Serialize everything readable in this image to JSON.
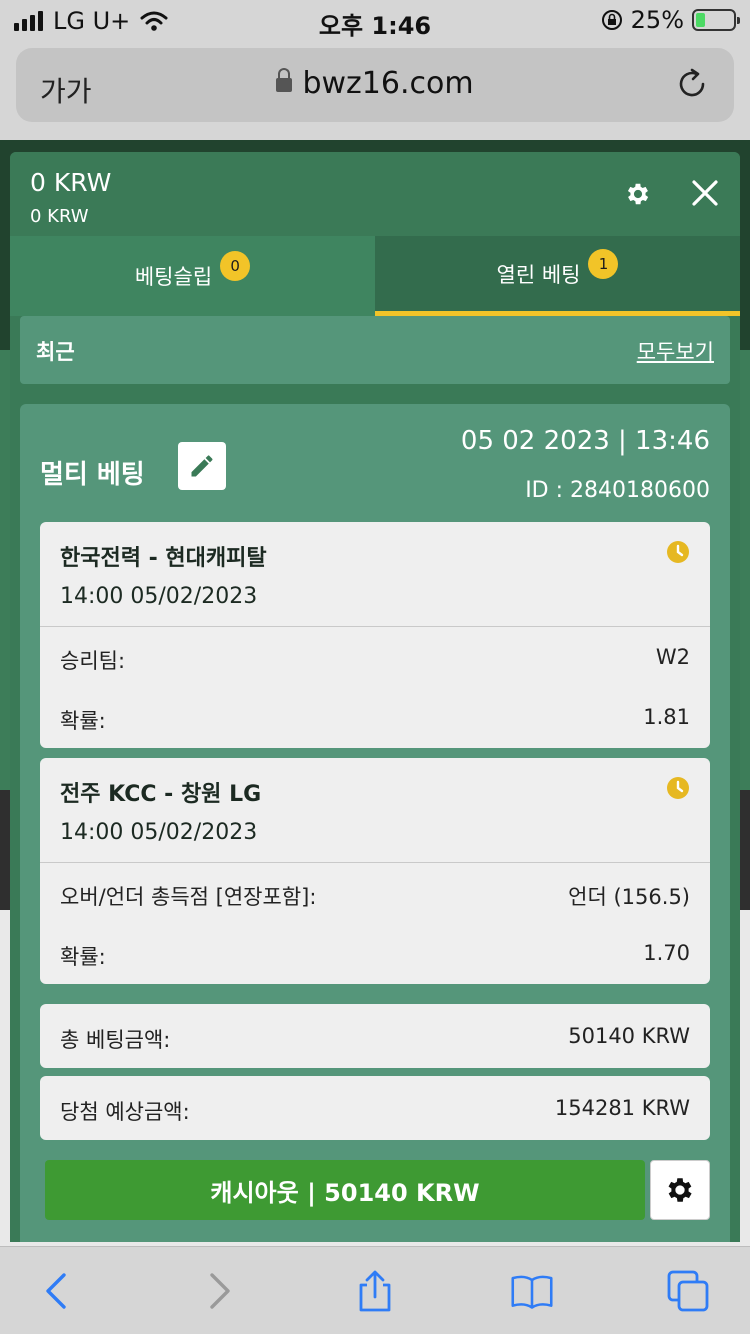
{
  "status": {
    "carrier": "LG U+",
    "time": "오후 1:46",
    "battery": "25%"
  },
  "browser": {
    "text_size": "가가",
    "url": "bwz16.com"
  },
  "panel": {
    "balance_main": "0 KRW",
    "balance_sub": "0 KRW",
    "tabs": [
      {
        "label": "베팅슬립",
        "count": "0"
      },
      {
        "label": "열린 베팅",
        "count": "1"
      }
    ],
    "recent_label": "최근",
    "view_all": "모두보기"
  },
  "ticket": {
    "title": "멀티 베팅",
    "date": "05 02 2023 | 13:46",
    "id": "ID : 2840180600",
    "events": [
      {
        "name": "한국전력 - 현대캐피탈",
        "time": "14:00   05/02/2023",
        "market_label": "승리팀:",
        "market_value": "W2",
        "odds_label": "확률:",
        "odds_value": "1.81"
      },
      {
        "name": "전주 KCC - 창원 LG",
        "time": "14:00   05/02/2023",
        "market_label": "오버/언더 총득점 [연장포함]:",
        "market_value": "언더 (156.5)",
        "odds_label": "확률:",
        "odds_value": "1.70"
      }
    ],
    "total_label": "총 베팅금액:",
    "total_value": "50140 KRW",
    "win_label": "당첨 예상금액:",
    "win_value": "154281 KRW",
    "cashout_label": "캐시아웃 | 50140 KRW"
  },
  "colors": {
    "panel_green": "#3a7a57",
    "card_green": "#55967a",
    "accent_yellow": "#f2c428",
    "cashout_green": "#3e9a33",
    "ios_blue": "#2f7cf6"
  },
  "icons": [
    "signal-icon",
    "wifi-icon",
    "orientation-lock-icon",
    "battery-icon",
    "lock-icon",
    "reload-icon",
    "gear-icon",
    "close-icon",
    "pencil-icon",
    "clock-icon",
    "back-icon",
    "forward-icon",
    "share-icon",
    "bookmarks-icon",
    "tabs-icon"
  ]
}
